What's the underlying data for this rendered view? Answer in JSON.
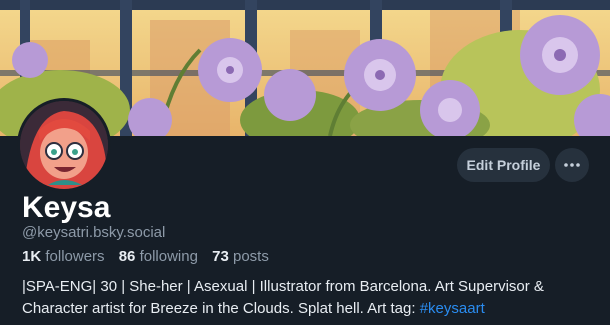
{
  "profile": {
    "display_name": "Keysa",
    "handle": "@keysatri.bsky.social",
    "followers_count": "1K",
    "followers_label": "followers",
    "following_count": "86",
    "following_label": "following",
    "posts_count": "73",
    "posts_label": "posts",
    "bio_text": "|SPA-ENG| 30 | She-her | Asexual | Illustrator from Barcelona. Art Supervisor & Character artist for Breeze in the Clouds. Splat hell. Art tag: ",
    "bio_tag": "#keysaart"
  },
  "actions": {
    "edit_label": "Edit Profile",
    "more_icon": "ellipsis-icon"
  },
  "colors": {
    "background": "#161e27",
    "accent": "#2a8cf0",
    "button_bg": "#26313d",
    "text_primary": "#e8edf2",
    "text_secondary": "#8d9aa8"
  }
}
